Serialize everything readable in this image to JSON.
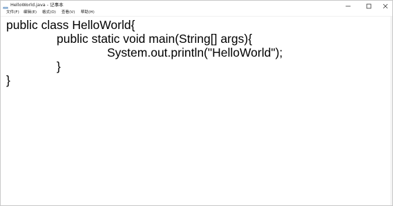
{
  "window": {
    "title": "HelloWorld.java - 记事本",
    "minimize_symbol": "—",
    "maximize_symbol": "☐",
    "close_symbol": "✕"
  },
  "menu": {
    "items": [
      {
        "label": "文件(F)"
      },
      {
        "label": "编辑(E)"
      },
      {
        "label": "格式(O)"
      },
      {
        "label": "查看(V)"
      },
      {
        "label": "帮助(H)"
      }
    ]
  },
  "editor": {
    "lines": [
      "public class HelloWorld{",
      "public static void main(String[] args){",
      "System.out.println(\"HelloWorld\");",
      "}",
      "}"
    ]
  },
  "icons": {
    "app": "notepad-icon",
    "minimize": "minimize-icon",
    "maximize": "maximize-icon",
    "close": "close-icon"
  }
}
